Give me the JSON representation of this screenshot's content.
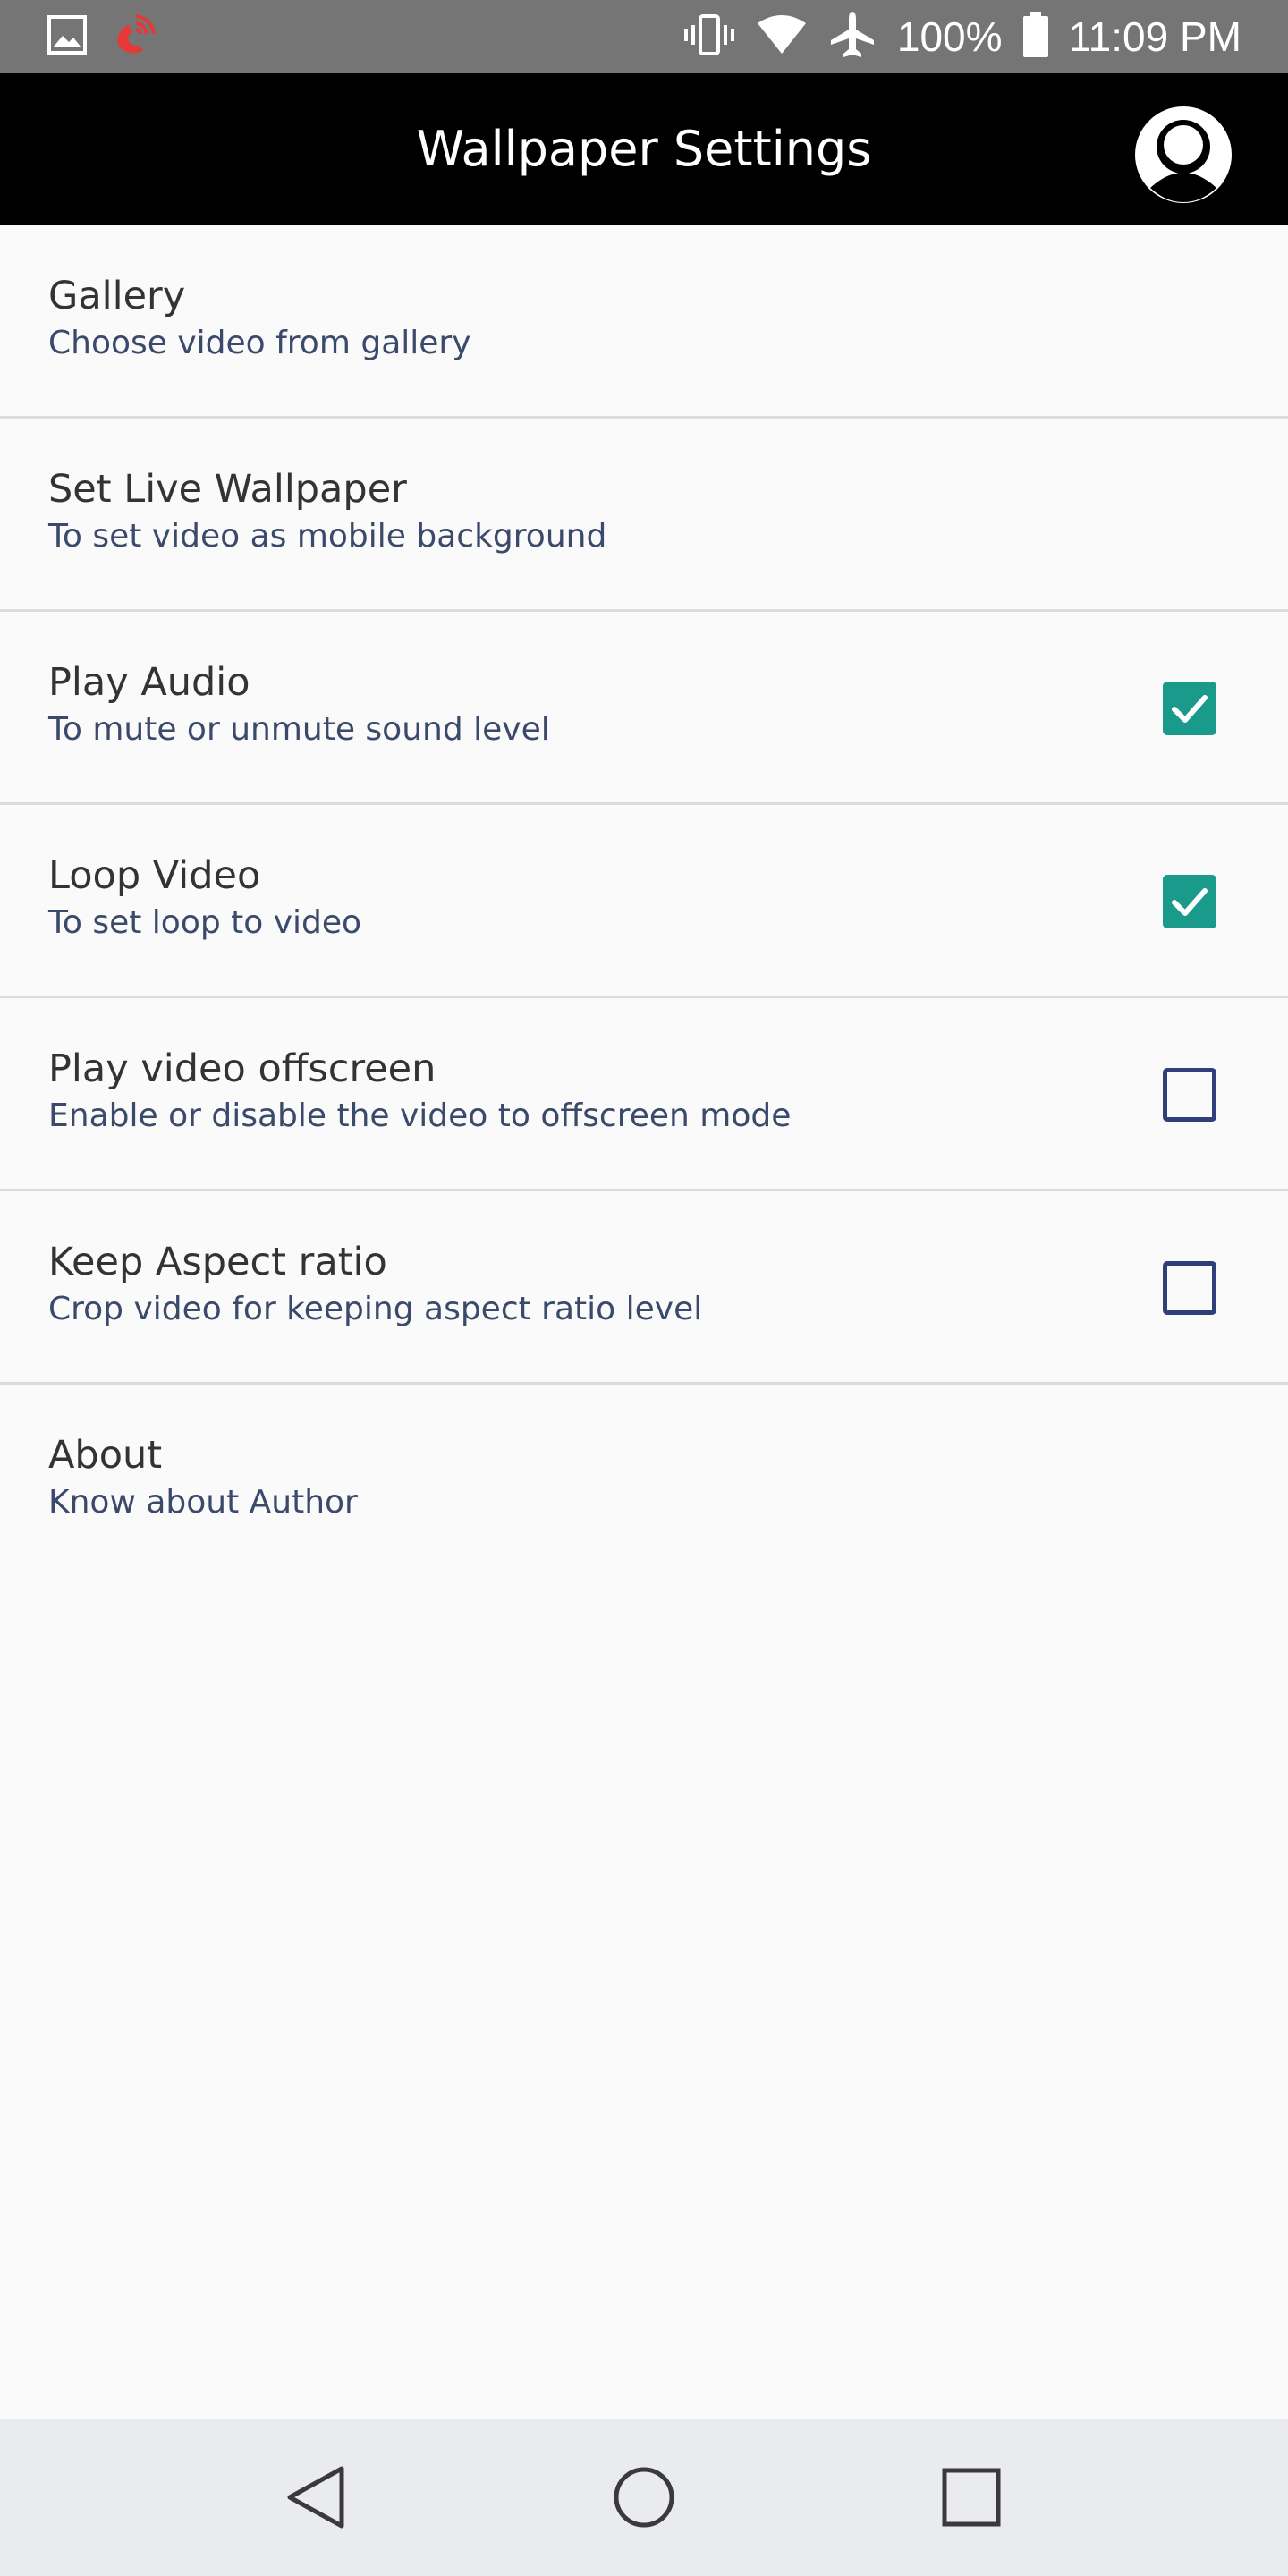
{
  "status_bar": {
    "battery_text": "100%",
    "time": "11:09 PM",
    "icons": [
      "image-icon",
      "phone-call-icon",
      "vibrate-icon",
      "wifi-icon",
      "airplane-icon",
      "battery-icon"
    ]
  },
  "app_bar": {
    "title": "Wallpaper Settings",
    "avatar_icon": "account-icon"
  },
  "settings": [
    {
      "title": "Gallery",
      "subtitle": "Choose video from gallery",
      "checkbox": null
    },
    {
      "title": "Set Live Wallpaper",
      "subtitle": "To set video as mobile background",
      "checkbox": null
    },
    {
      "title": "Play Audio",
      "subtitle": "To mute or unmute sound level",
      "checkbox": true
    },
    {
      "title": "Loop Video",
      "subtitle": "To set loop to video",
      "checkbox": true
    },
    {
      "title": "Play video offscreen",
      "subtitle": "Enable or disable the video to offscreen mode",
      "checkbox": false
    },
    {
      "title": "Keep Aspect ratio",
      "subtitle": "Crop video for keeping aspect ratio level",
      "checkbox": false
    },
    {
      "title": "About",
      "subtitle": "Know about Author",
      "checkbox": null
    }
  ],
  "colors": {
    "app_bar": "#000000",
    "status_bar": "#757575",
    "checkbox_checked": "#1a9a8a",
    "checkbox_unchecked_border": "#2f3f7a",
    "subtitle": "#3b4a6b"
  },
  "nav_bar": {
    "icons": [
      "back-icon",
      "home-icon",
      "recents-icon"
    ]
  }
}
